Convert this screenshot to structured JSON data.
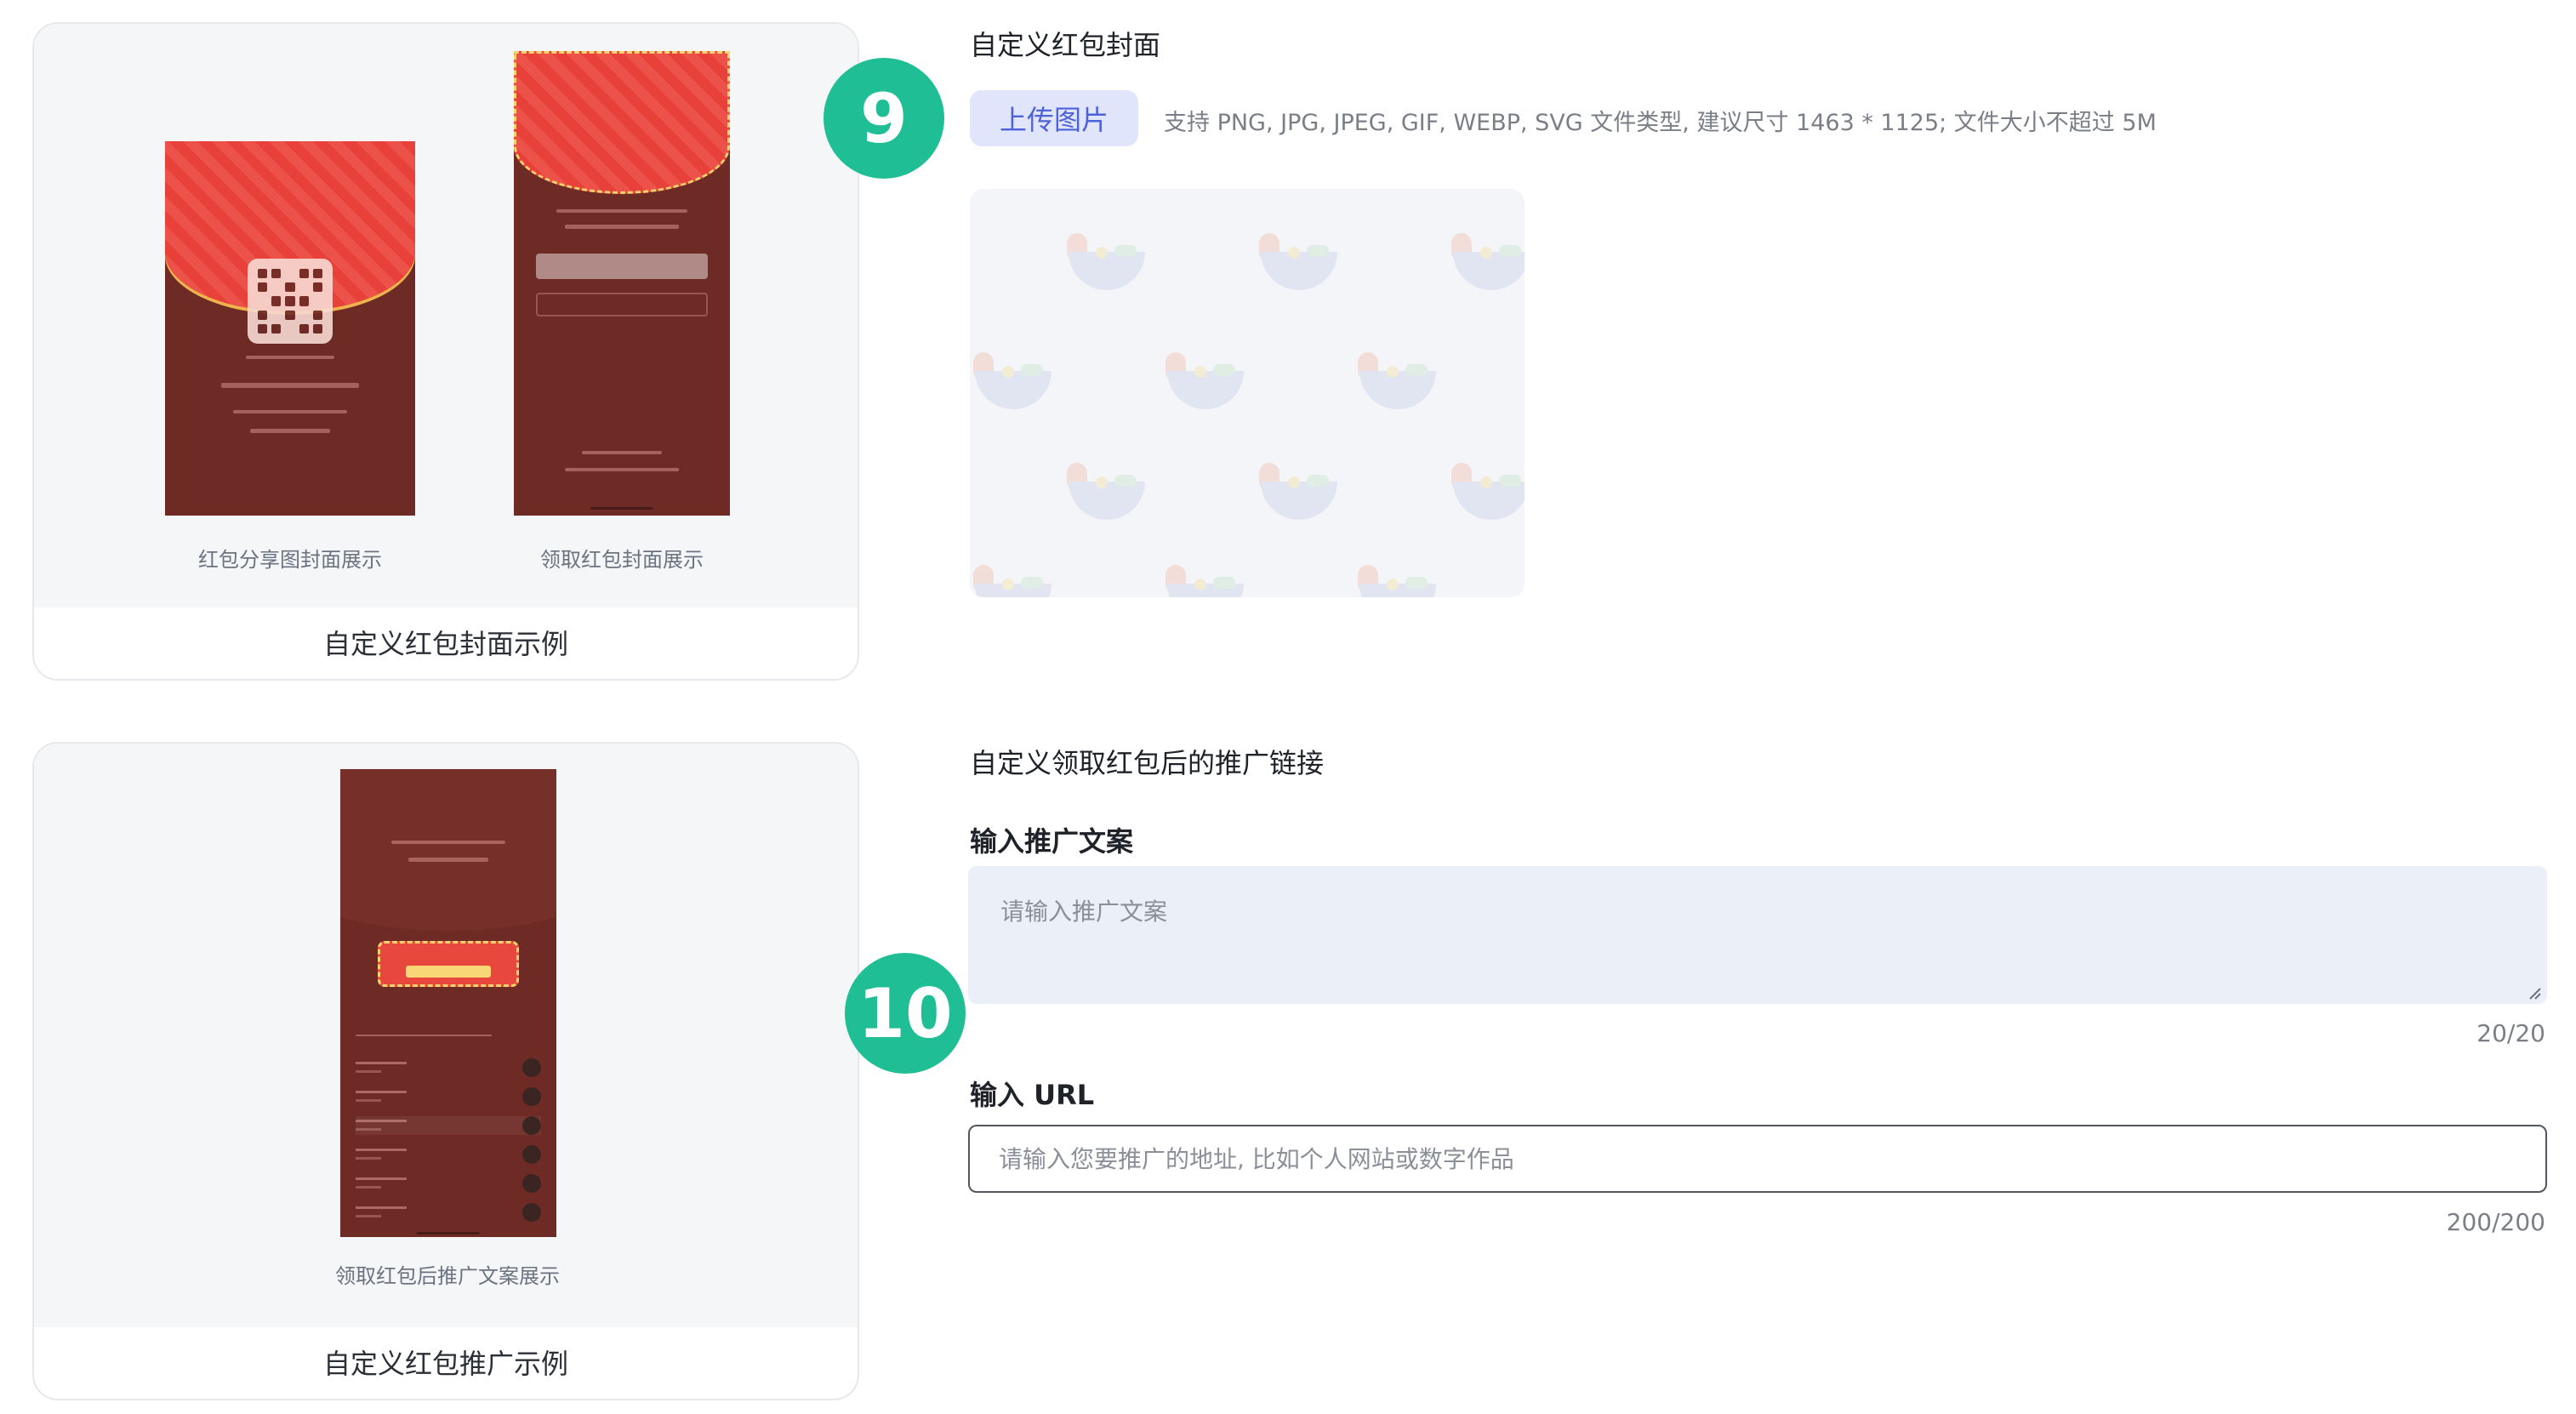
{
  "cover_example": {
    "share_caption": "红包分享图封面展示",
    "receive_caption": "领取红包封面展示",
    "footer": "自定义红包封面示例"
  },
  "promo_example": {
    "caption": "领取红包后推广文案展示",
    "footer": "自定义红包推广示例"
  },
  "steps": {
    "cover": "9",
    "promo": "10"
  },
  "cover_section": {
    "title": "自定义红包封面",
    "upload_button": "上传图片",
    "upload_hint": "支持 PNG, JPG, JPEG, GIF, WEBP, SVG 文件类型, 建议尺寸 1463 * 1125; 文件大小不超过 5M"
  },
  "promo_section": {
    "title": "自定义领取红包后的推广链接",
    "copy_label": "输入推广文案",
    "copy_placeholder": "请输入推广文案",
    "copy_counter": "20/20",
    "url_label": "输入 URL",
    "url_placeholder": "请输入您要推广的地址, 比如个人网站或数字作品",
    "url_counter": "200/200"
  },
  "colors": {
    "accent_badge": "#1fbe95",
    "upload_button_bg": "#e0e5fb",
    "upload_button_text": "#4d62d8",
    "envelope_red": "#e8413a",
    "envelope_dark": "#6e2b26"
  }
}
